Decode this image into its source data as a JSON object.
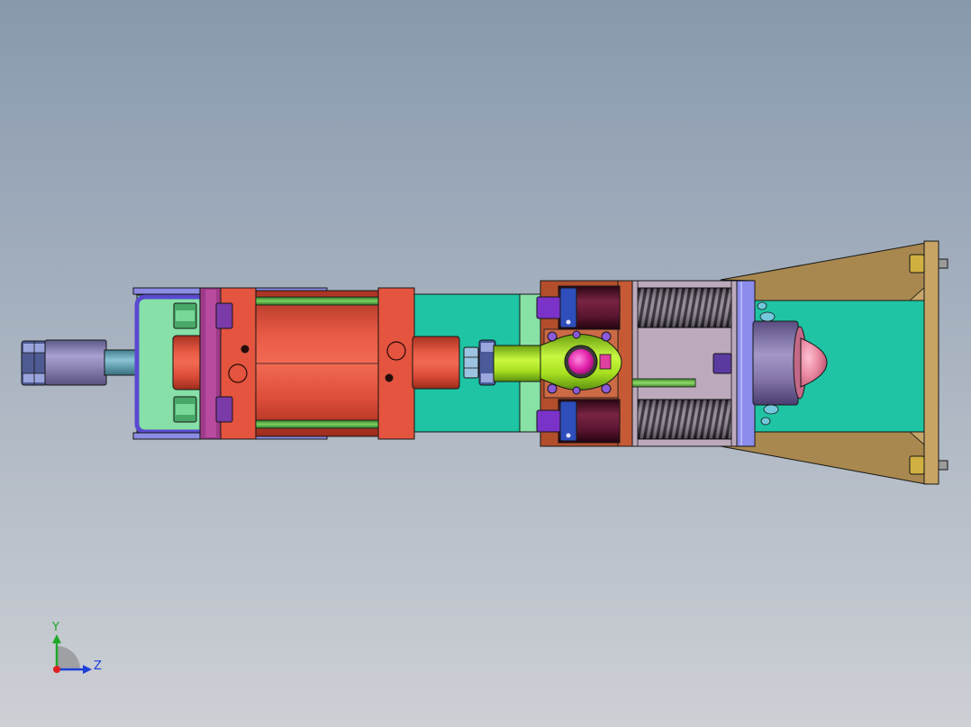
{
  "viewport": {
    "background_top": "#8899ae",
    "background_bottom": "#cdd0d5"
  },
  "triad": {
    "icon": "axis-triad-icon",
    "y_label": "Y",
    "z_label": "Z",
    "y_color": "#1fa82a",
    "z_color": "#1c3ed8",
    "origin_color": "#e02020"
  }
}
